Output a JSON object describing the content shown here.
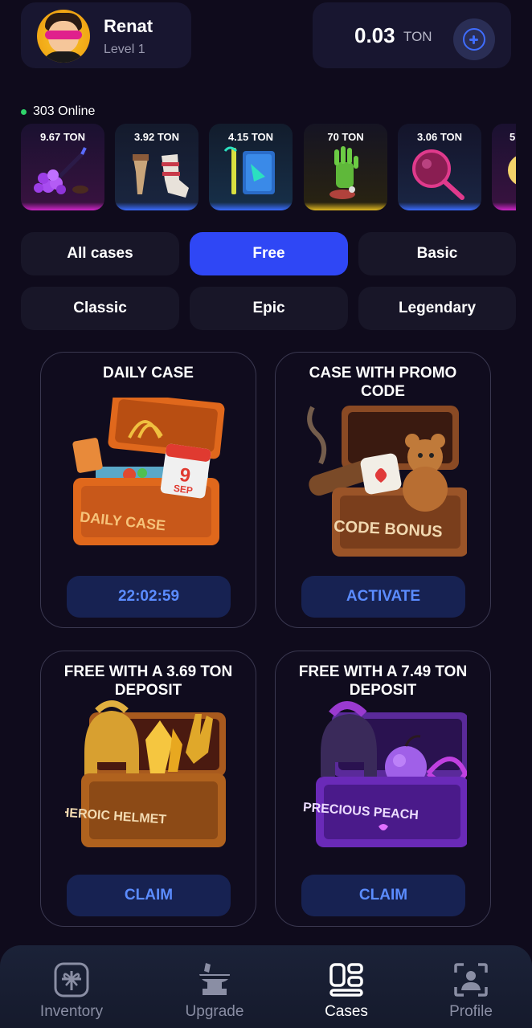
{
  "user": {
    "name": "Renat",
    "level": "Level 1"
  },
  "balance": {
    "amount": "0.03",
    "unit": "TON"
  },
  "online": {
    "text": "303 Online"
  },
  "drops": [
    {
      "price": "9.67 TON",
      "item": "purple-grape-brush",
      "glow": "#d026c9"
    },
    {
      "price": "3.92 TON",
      "item": "socks-and-cup",
      "glow": "#3a6cff"
    },
    {
      "price": "4.15 TON",
      "item": "notebook-and-pen",
      "glow": "#3a6cff"
    },
    {
      "price": "70 TON",
      "item": "zombie-hand",
      "glow": "#e0b820"
    },
    {
      "price": "3.06 TON",
      "item": "magnifier",
      "glow": "#3a6cff"
    },
    {
      "price": "5",
      "item": "partial-item",
      "glow": "#d026c9"
    }
  ],
  "filters": [
    "All cases",
    "Free",
    "Basic",
    "Classic",
    "Epic",
    "Legendary"
  ],
  "active_filter": "Free",
  "cases": [
    {
      "title": "DAILY CASE",
      "button": "22:02:59",
      "art": "daily-case-chest",
      "chest_label": "DAILY CASE",
      "calendar_day": "9",
      "calendar_month": "SEP"
    },
    {
      "title": "CASE WITH PROMO CODE",
      "button": "ACTIVATE",
      "art": "code-bonus-chest",
      "chest_label": "CODE BONUS"
    },
    {
      "title": "FREE WITH A 3.69 TON DEPOSIT",
      "button": "CLAIM",
      "art": "heroic-helmet-chest",
      "chest_label": "HEROIC HELMET"
    },
    {
      "title": "FREE WITH A 7.49 TON DEPOSIT",
      "button": "CLAIM",
      "art": "precious-peach-chest",
      "chest_label": "PRECIOUS PEACH"
    }
  ],
  "nav": [
    {
      "label": "Inventory",
      "icon": "gift-box-icon"
    },
    {
      "label": "Upgrade",
      "icon": "anvil-icon"
    },
    {
      "label": "Cases",
      "icon": "cases-grid-icon",
      "active": true
    },
    {
      "label": "Profile",
      "icon": "profile-scan-icon"
    }
  ],
  "colors": {
    "accent": "#2f47f5",
    "button_text": "#5b8cff",
    "online": "#2fd36a"
  }
}
